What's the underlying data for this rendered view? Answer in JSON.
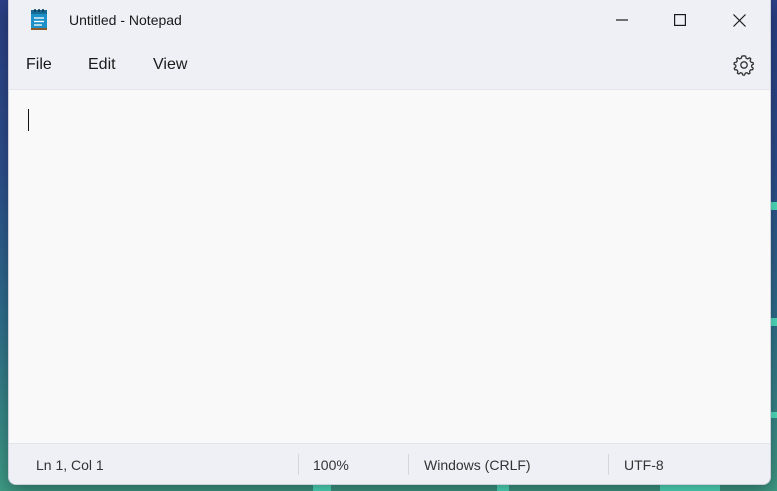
{
  "window": {
    "title": "Untitled - Notepad",
    "app_icon": "notepad-icon",
    "controls": {
      "minimize_icon": "minimize-icon",
      "maximize_icon": "maximize-icon",
      "close_icon": "close-icon"
    }
  },
  "menubar": {
    "items": [
      {
        "label": "File"
      },
      {
        "label": "Edit"
      },
      {
        "label": "View"
      }
    ],
    "settings_icon": "gear-icon"
  },
  "editor": {
    "content": ""
  },
  "statusbar": {
    "position": "Ln 1, Col 1",
    "zoom": "100%",
    "line_ending": "Windows (CRLF)",
    "encoding": "UTF-8"
  },
  "colors": {
    "chrome_bg": "#eef0f6",
    "editor_bg": "#f9f9f9",
    "desktop_accent": "#51e3c3",
    "icon_blue": "#1e90c8"
  }
}
